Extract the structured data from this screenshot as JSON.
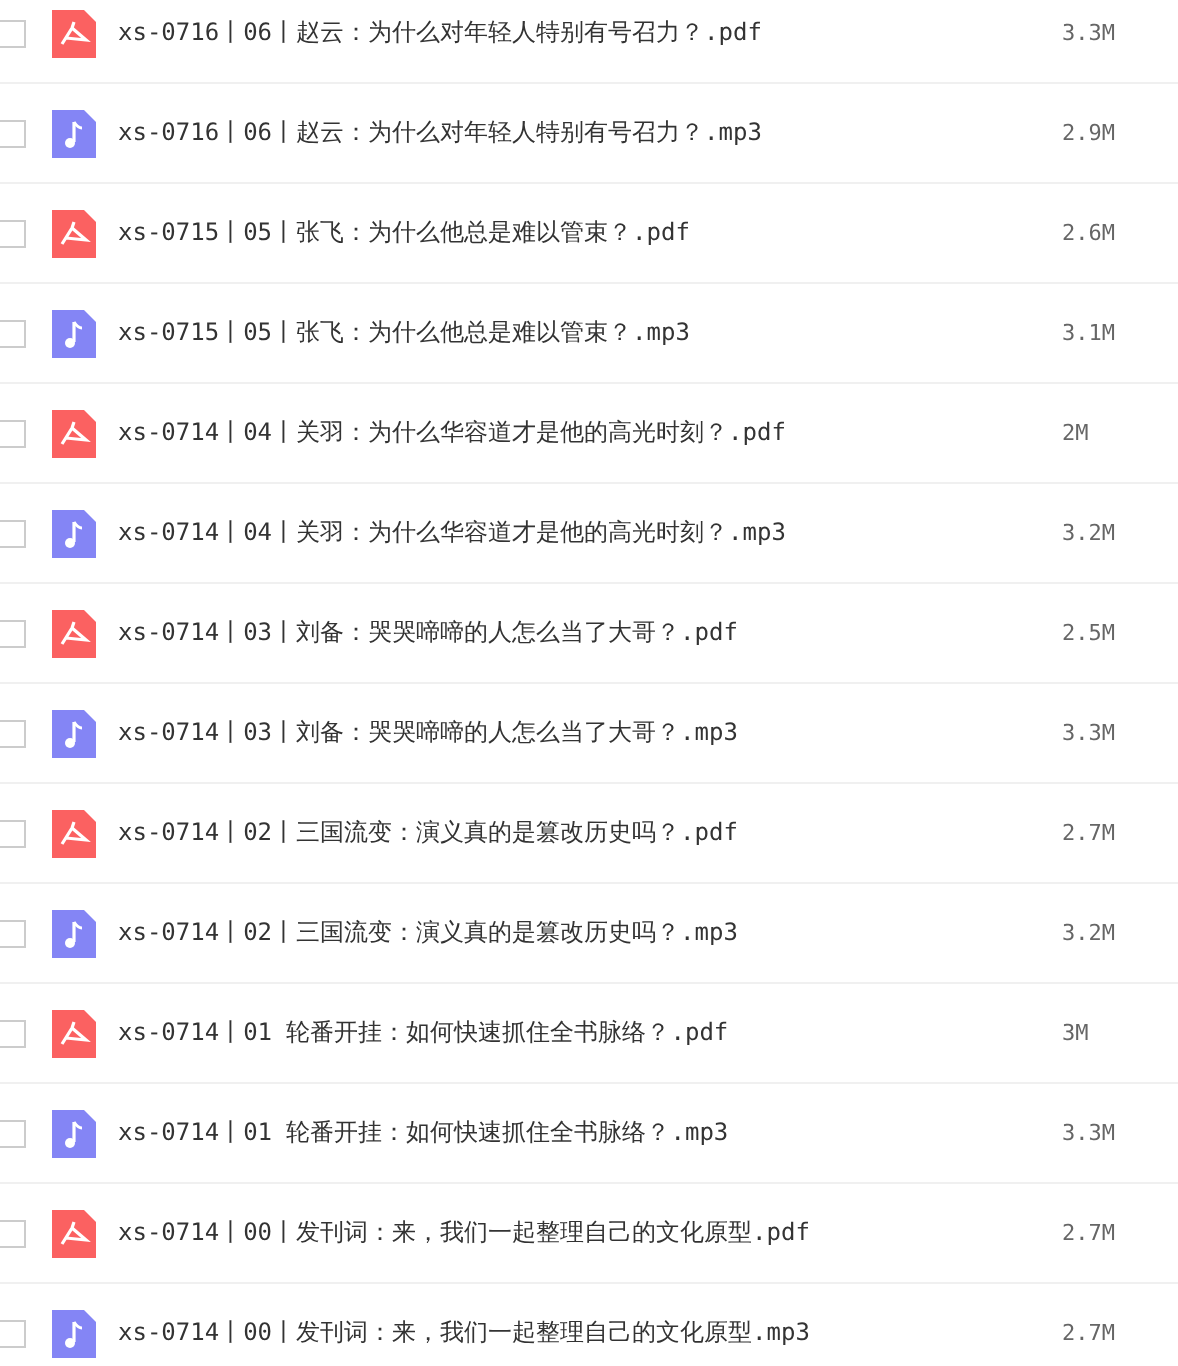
{
  "files": [
    {
      "kind": "pdf",
      "checked": false,
      "name": "xs-0716丨06丨赵云：为什么对年轻人特别有号召力？.pdf",
      "size": "3.3M"
    },
    {
      "kind": "mp3",
      "checked": false,
      "name": "xs-0716丨06丨赵云：为什么对年轻人特别有号召力？.mp3",
      "size": "2.9M"
    },
    {
      "kind": "pdf",
      "checked": false,
      "name": "xs-0715丨05丨张飞：为什么他总是难以管束？.pdf",
      "size": "2.6M"
    },
    {
      "kind": "mp3",
      "checked": false,
      "name": "xs-0715丨05丨张飞：为什么他总是难以管束？.mp3",
      "size": "3.1M"
    },
    {
      "kind": "pdf",
      "checked": false,
      "name": "xs-0714丨04丨关羽：为什么华容道才是他的高光时刻？.pdf",
      "size": "2M"
    },
    {
      "kind": "mp3",
      "checked": false,
      "name": "xs-0714丨04丨关羽：为什么华容道才是他的高光时刻？.mp3",
      "size": "3.2M"
    },
    {
      "kind": "pdf",
      "checked": false,
      "name": "xs-0714丨03丨刘备：哭哭啼啼的人怎么当了大哥？.pdf",
      "size": "2.5M"
    },
    {
      "kind": "mp3",
      "checked": false,
      "name": "xs-0714丨03丨刘备：哭哭啼啼的人怎么当了大哥？.mp3",
      "size": "3.3M"
    },
    {
      "kind": "pdf",
      "checked": false,
      "name": "xs-0714丨02丨三国流变：演义真的是篡改历史吗？.pdf",
      "size": "2.7M"
    },
    {
      "kind": "mp3",
      "checked": false,
      "name": "xs-0714丨02丨三国流变：演义真的是篡改历史吗？.mp3",
      "size": "3.2M"
    },
    {
      "kind": "pdf",
      "checked": false,
      "name": "xs-0714丨01 轮番开挂：如何快速抓住全书脉络？.pdf",
      "size": "3M"
    },
    {
      "kind": "mp3",
      "checked": false,
      "name": "xs-0714丨01 轮番开挂：如何快速抓住全书脉络？.mp3",
      "size": "3.3M"
    },
    {
      "kind": "pdf",
      "checked": false,
      "name": "xs-0714丨00丨发刊词：来，我们一起整理自己的文化原型.pdf",
      "size": "2.7M"
    },
    {
      "kind": "mp3",
      "checked": false,
      "name": "xs-0714丨00丨发刊词：来，我们一起整理自己的文化原型.mp3",
      "size": "2.7M"
    }
  ]
}
